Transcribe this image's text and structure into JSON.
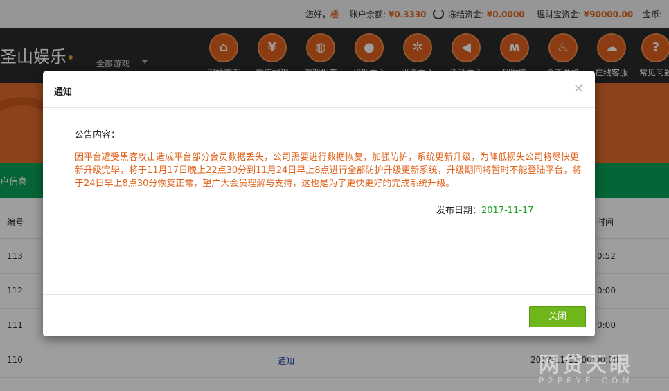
{
  "topbar": {
    "greeting": "您好，",
    "username": "楼",
    "balance_label": "账户余额:",
    "balance": "¥0.3330",
    "frozen_label": "冻结资金:",
    "frozen": "¥0.0000",
    "licai_label": "理财宝资金:",
    "licai": "¥90000.00",
    "coins_label": "金币:"
  },
  "nav": {
    "logo": "圣山娱乐",
    "all_games": "全部游戏",
    "items": [
      {
        "label": "网站首页",
        "icon": "⌂"
      },
      {
        "label": "充值提现",
        "icon": "¥"
      },
      {
        "label": "游戏报表",
        "icon": "◍"
      },
      {
        "label": "代理中心",
        "icon": "●"
      },
      {
        "label": "账户中心",
        "icon": "✲"
      },
      {
        "label": "活动中心",
        "icon": "◀"
      },
      {
        "label": "理财宝",
        "icon": "ʍ"
      },
      {
        "label": "金币兑换",
        "icon": "♨"
      },
      {
        "label": "在线客服",
        "icon": "☁"
      },
      {
        "label": "常见问题",
        "icon": "?"
      }
    ]
  },
  "greenbar": {
    "label": "户信息"
  },
  "table": {
    "headers": {
      "id": "编号",
      "time": "时间"
    },
    "rows": [
      {
        "id": "113",
        "title": "",
        "time": "0:52"
      },
      {
        "id": "112",
        "title": "",
        "time": "0:00"
      },
      {
        "id": "111",
        "title": "",
        "time": "0:00"
      },
      {
        "id": "110",
        "title": "通知",
        "time": "2017-11-11 00:00:00"
      }
    ]
  },
  "modal": {
    "title": "通知",
    "close_icon": "×",
    "content_label": "公告内容：",
    "content": "因平台遭受黑客攻击造成平台部分会员数据丢失，公司需要进行数据恢复，加强防护，系统更新升级，为降低损失公司将尽快更新升级完毕，将于11月17日晚上22点30分到11月24日早上8点进行全部防护升级更新系统，升级期间将暂时不能登陆平台，将于24日早上8点30分恢复正常，望广大会员理解与支持，这也是为了更快更好的完成系统升级。",
    "date_label": "发布日期：",
    "date": "2017-11-17",
    "close_button": "关闭"
  },
  "watermark": {
    "main": "网贷天眼",
    "sub": "P2PEYE.COM"
  },
  "colors": {
    "accent": "#e0641d",
    "nav_bg": "#2a2a2a",
    "green": "#0aa35a",
    "button": "#6fb61a"
  }
}
